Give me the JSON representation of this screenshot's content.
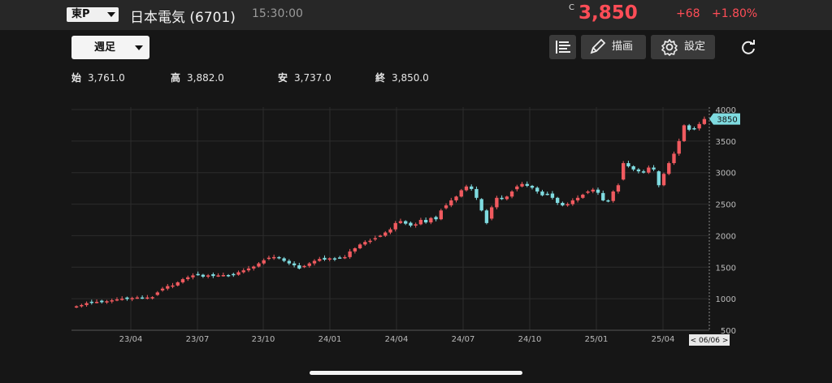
{
  "header": {
    "market": "東P",
    "name": "日本電気 (6701)",
    "time": "15:30:00",
    "c_mark": "C",
    "price": "3,850",
    "change": "+68",
    "change_pct": "+1.80%",
    "up_color": "#ff4d57"
  },
  "toolbar": {
    "period": "週足",
    "draw_label": "描画",
    "settings_label": "設定"
  },
  "ohlc": {
    "open_label": "始",
    "open": "3,761.0",
    "high_label": "高",
    "high": "3,882.0",
    "low_label": "安",
    "low": "3,737.0",
    "close_label": "終",
    "close": "3,850.0"
  },
  "chart_data": {
    "type": "candlestick",
    "ylim": [
      500,
      4000
    ],
    "yticks": [
      500,
      1000,
      1500,
      2000,
      2500,
      3000,
      3500,
      4000
    ],
    "xtick_labels": [
      "23/04",
      "23/07",
      "23/10",
      "24/01",
      "24/04",
      "24/07",
      "24/10",
      "25/01",
      "25/04"
    ],
    "last_price_label": "3850",
    "cursor_date_label": "< 06/06 >",
    "grid": true,
    "colors": {
      "up": "#f05a5f",
      "down": "#7fdbe0",
      "grid": "#2c2c2c",
      "axis": "#bbbbbb"
    },
    "closes": [
      880,
      900,
      930,
      940,
      950,
      945,
      960,
      975,
      990,
      1000,
      995,
      1010,
      1020,
      1015,
      1020,
      1025,
      1100,
      1160,
      1200,
      1210,
      1260,
      1310,
      1340,
      1370,
      1380,
      1350,
      1370,
      1360,
      1370,
      1375,
      1370,
      1380,
      1420,
      1450,
      1480,
      1510,
      1560,
      1610,
      1650,
      1660,
      1640,
      1600,
      1560,
      1530,
      1480,
      1520,
      1560,
      1600,
      1630,
      1620,
      1640,
      1630,
      1650,
      1660,
      1750,
      1800,
      1860,
      1900,
      1920,
      1960,
      2000,
      2050,
      2100,
      2200,
      2230,
      2190,
      2160,
      2180,
      2250,
      2210,
      2280,
      2260,
      2400,
      2480,
      2560,
      2620,
      2720,
      2780,
      2740,
      2600,
      2400,
      2200,
      2450,
      2600,
      2580,
      2620,
      2700,
      2780,
      2820,
      2790,
      2760,
      2700,
      2640,
      2660,
      2600,
      2520,
      2480,
      2500,
      2560,
      2600,
      2650,
      2700,
      2730,
      2680,
      2560,
      2550,
      2700,
      2800,
      3150,
      3100,
      3050,
      3020,
      3000,
      3080,
      3050,
      2800,
      2980,
      3150,
      3300,
      3500,
      3750,
      3680,
      3700,
      3770,
      3850
    ]
  }
}
